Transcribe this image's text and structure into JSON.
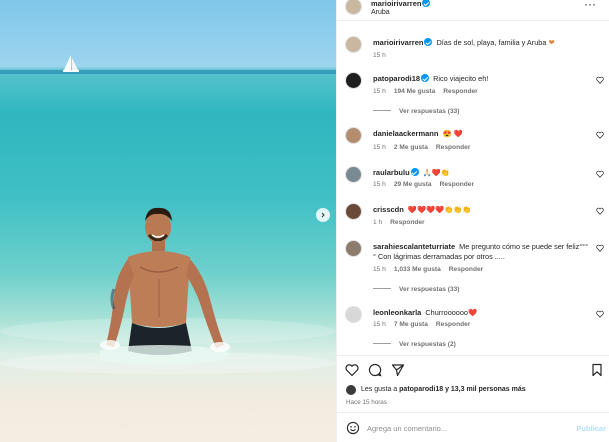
{
  "post": {
    "username": "marioirivarren",
    "location": "Aruba",
    "caption": "Días de sol, playa, familia y Aruba",
    "caption_time": "15 h"
  },
  "comments": [
    {
      "user": "patoparodi18",
      "text": "Rico viajecito eh!",
      "time": "15 h",
      "likes": "194 Me gusta",
      "reply": "Responder",
      "view_replies": "Ver respuestas (33)",
      "verified": true,
      "avatar_color": "#1f1f1f"
    },
    {
      "user": "danielaackermann",
      "text": "😍 ❤️",
      "time": "15 h",
      "likes": "2 Me gusta",
      "reply": "Responder",
      "verified": false,
      "avatar_color": "#b48c6e"
    },
    {
      "user": "raularbulu",
      "text": "🙏🏻❤️👏",
      "time": "15 h",
      "likes": "29 Me gusta",
      "reply": "Responder",
      "verified": true,
      "avatar_color": "#7a8a92"
    },
    {
      "user": "crisscdn",
      "text": "❤️❤️❤️❤️👏👏👏",
      "time": "1 h",
      "reply": "Responder",
      "verified": false,
      "avatar_color": "#6b4a3a"
    },
    {
      "user": "sarahiescalanteturriate",
      "text": "Me pregunto cómo se puede ser feliz°°°° Con lágrimas derramadas por otros .....",
      "time": "15 h",
      "likes": "1,033 Me gusta",
      "reply": "Responder",
      "view_replies": "Ver respuestas (33)",
      "verified": false,
      "avatar_color": "#8d7b6c"
    },
    {
      "user": "leonleonkarla",
      "text": "Churroooooo❤️",
      "time": "15 h",
      "likes": "7 Me gusta",
      "reply": "Responder",
      "view_replies": "Ver respuestas (2)",
      "verified": false,
      "avatar_color": "#d8d8d8"
    }
  ],
  "likes_bar": {
    "prefix": "Les gusta a",
    "user": "patoparodi18",
    "suffix": "y 13,3 mil personas más",
    "time_ago": "Hace 15 horas"
  },
  "composer": {
    "placeholder": "Agrega un comentario...",
    "post_label": "Publicar"
  },
  "icons": {
    "header_more": "more-horizontal-icon",
    "like": "heart-icon",
    "comment": "comment-icon",
    "share": "share-icon",
    "save": "bookmark-icon",
    "emoji": "emoji-icon",
    "next": "chevron-right-icon"
  },
  "colors": {
    "verified": "#0095f6",
    "post_button": "#b2dffc",
    "secondary_text": "#737373"
  }
}
